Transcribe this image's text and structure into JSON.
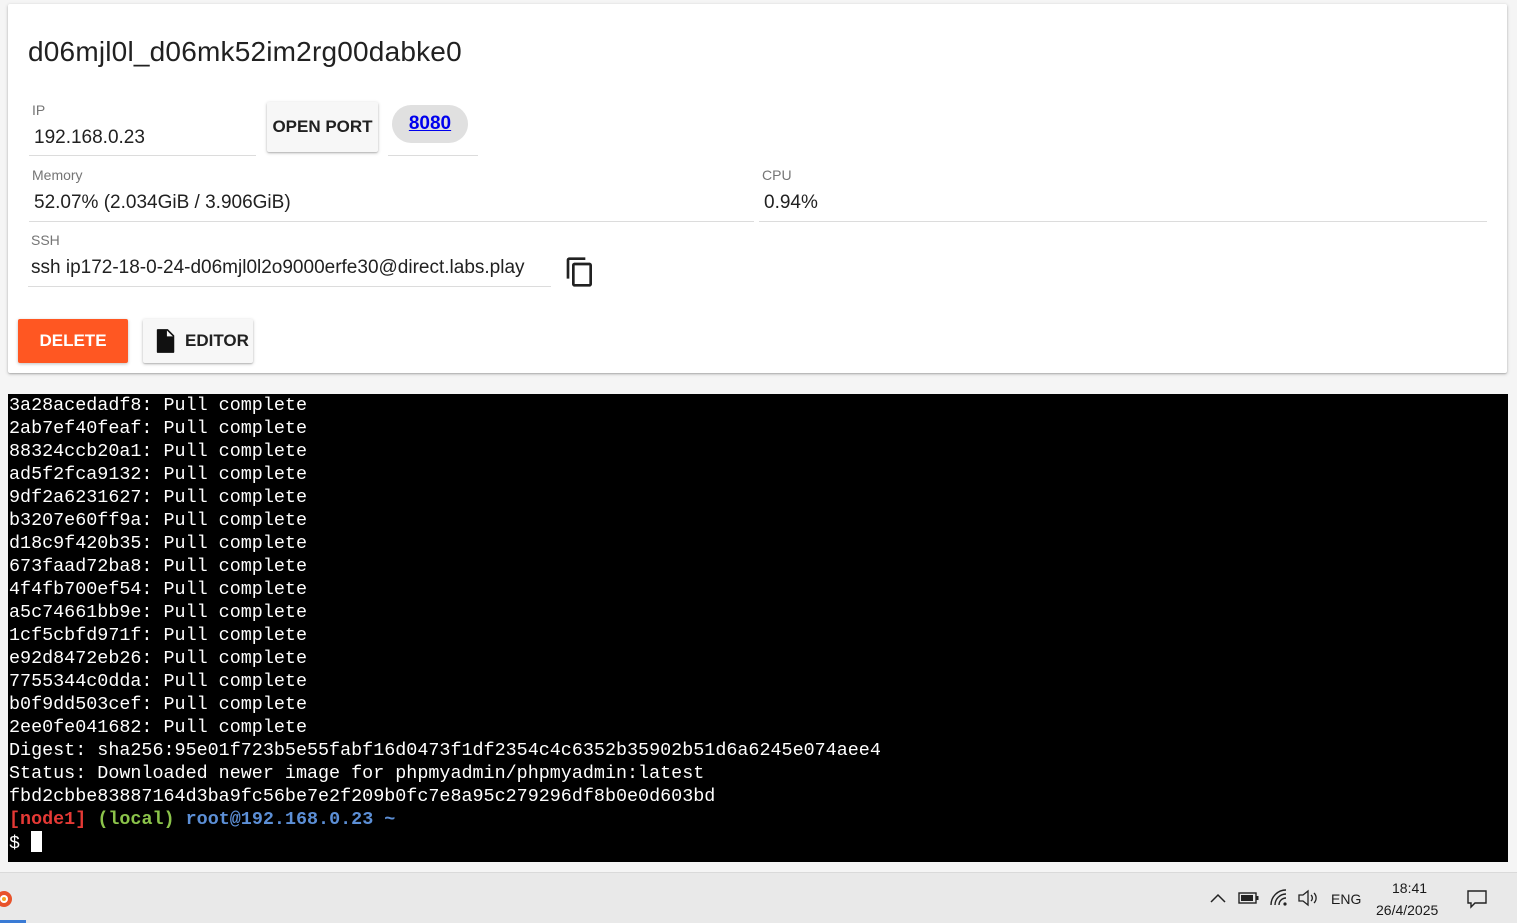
{
  "header": {
    "title": "d06mjl0l_d06mk52im2rg00dabke0"
  },
  "ip": {
    "label": "IP",
    "value": "192.168.0.23"
  },
  "open_port_label": "OPEN PORT",
  "port": "8080",
  "memory": {
    "label": "Memory",
    "value": "52.07% (2.034GiB / 3.906GiB)"
  },
  "cpu": {
    "label": "CPU",
    "value": "0.94%"
  },
  "ssh": {
    "label": "SSH",
    "value": "ssh ip172-18-0-24-d06mjl0l2o9000erfe30@direct.labs.play"
  },
  "actions": {
    "delete_label": "DELETE",
    "editor_label": "EDITOR"
  },
  "colors": {
    "delete": "#ff5722",
    "terminal_bg": "#000000",
    "prompt_node": "#e53935",
    "prompt_local": "#8bc34a",
    "prompt_user": "#5c8fd6"
  },
  "terminal": {
    "lines": [
      "3a28acedadf8: Pull complete",
      "2ab7ef40feaf: Pull complete",
      "88324ccb20a1: Pull complete",
      "ad5f2fca9132: Pull complete",
      "9df2a6231627: Pull complete",
      "b3207e60ff9a: Pull complete",
      "d18c9f420b35: Pull complete",
      "673faad72ba8: Pull complete",
      "4f4fb700ef54: Pull complete",
      "a5c74661bb9e: Pull complete",
      "1cf5cbfd971f: Pull complete",
      "e92d8472eb26: Pull complete",
      "7755344c0dda: Pull complete",
      "b0f9dd503cef: Pull complete",
      "2ee0fe041682: Pull complete",
      "Digest: sha256:95e01f723b5e55fabf16d0473f1df2354c4c6352b35902b51d6a6245e074aee4",
      "Status: Downloaded newer image for phpmyadmin/phpmyadmin:latest",
      "fbd2cbbe83887164d3ba9fc56be7e2f209b0fc7e8a95c279296df8b0e0d603bd"
    ],
    "prompt": {
      "node": "[node1]",
      "local": "(local)",
      "user": "root@192.168.0.23 ~",
      "symbol": "$"
    }
  },
  "taskbar": {
    "language": "ENG",
    "time": "18:41",
    "date": "26/4/2025",
    "icons": [
      "app-icon",
      "chevron-up-icon",
      "battery-icon",
      "wifi-icon",
      "volume-icon",
      "notification-icon"
    ]
  }
}
